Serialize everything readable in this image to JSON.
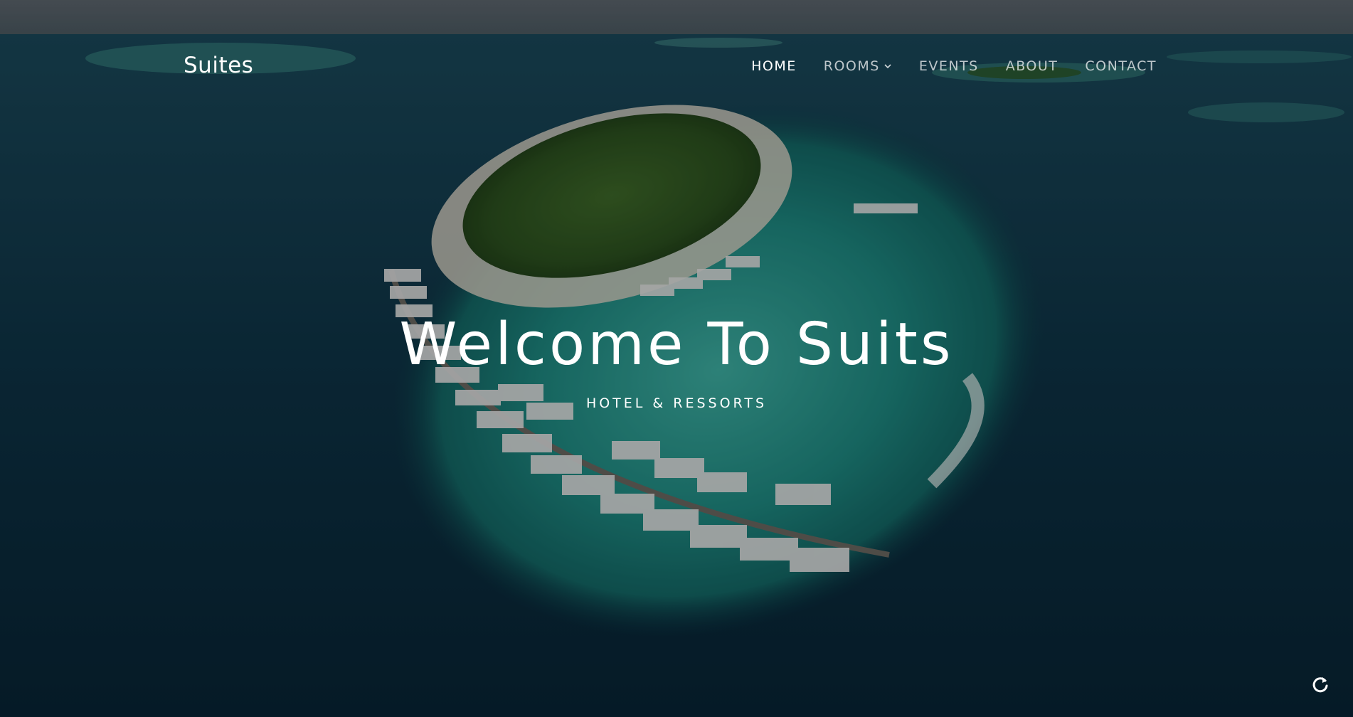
{
  "site": {
    "brand": "Suites"
  },
  "nav": {
    "items": [
      {
        "label": "HOME",
        "active": true,
        "has_dropdown": false
      },
      {
        "label": "ROOMS",
        "active": false,
        "has_dropdown": true,
        "icon": "chevron-down-icon"
      },
      {
        "label": "EVENTS",
        "active": false,
        "has_dropdown": false
      },
      {
        "label": "ABOUT",
        "active": false,
        "has_dropdown": false
      },
      {
        "label": "CONTACT",
        "active": false,
        "has_dropdown": false
      }
    ]
  },
  "hero": {
    "title": "Welcome To Suits",
    "subtitle": "HOTEL & RESSORTS"
  },
  "widgets": {
    "refresh_icon": "refresh-icon"
  },
  "colors": {
    "text": "#ffffff",
    "nav_inactive": "rgba(255,255,255,0.72)",
    "ocean_deep": "#0b2f45",
    "lagoon": "#1f8f8a"
  }
}
